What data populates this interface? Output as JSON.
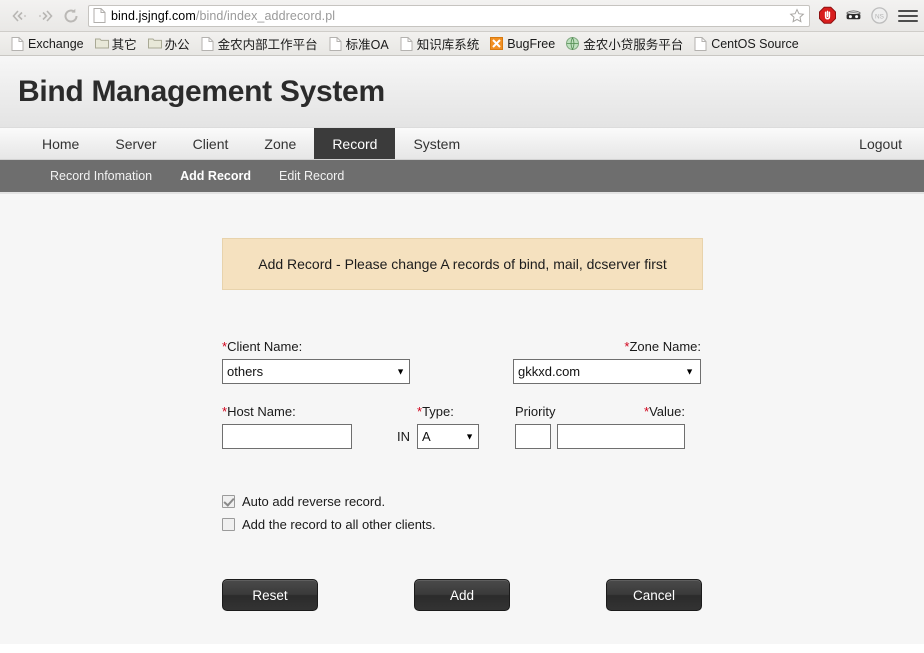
{
  "browser": {
    "back_label": "Back",
    "forward_label": "Forward",
    "reload_label": "Reload",
    "url_domain": "bind.jsjngf.com",
    "url_path": "/bind/index_addrecord.pl",
    "url_full": "bind.jsjngf.com/bind/index_addrecord.pl",
    "bookmark_star": "bookmark-star-icon",
    "extensions": [
      {
        "name": "adblock-icon",
        "label": "AdBlock"
      },
      {
        "name": "privacy-mask-icon",
        "label": "Privacy Badger"
      },
      {
        "name": "noscript-icon",
        "label": "NoScript"
      }
    ],
    "menu_label": "Open menu",
    "bookmarks": [
      {
        "label": "Exchange",
        "icon": "page-icon"
      },
      {
        "label": "其它",
        "icon": "folder-icon"
      },
      {
        "label": "办公",
        "icon": "folder-icon"
      },
      {
        "label": "金农内部工作平台",
        "icon": "page-icon"
      },
      {
        "label": "标准OA",
        "icon": "page-icon"
      },
      {
        "label": "知识库系统",
        "icon": "page-icon"
      },
      {
        "label": "BugFree",
        "icon": "bugfree-icon"
      },
      {
        "label": "金农小贷服务平台",
        "icon": "globe-icon"
      },
      {
        "label": "CentOS Source",
        "icon": "page-icon"
      }
    ]
  },
  "site": {
    "title": "Bind Management System",
    "mainnav": [
      {
        "label": "Home",
        "active": false
      },
      {
        "label": "Server",
        "active": false
      },
      {
        "label": "Client",
        "active": false
      },
      {
        "label": "Zone",
        "active": false
      },
      {
        "label": "Record",
        "active": true
      },
      {
        "label": "System",
        "active": false
      }
    ],
    "logout_label": "Logout",
    "subnav": [
      {
        "label": "Record Infomation",
        "active": false
      },
      {
        "label": "Add Record",
        "active": true
      },
      {
        "label": "Edit Record",
        "active": false
      }
    ]
  },
  "form": {
    "alert_text": "Add Record - Please change A records of bind, mail, dcserver first",
    "client_name": {
      "label_required": "*",
      "label": "Client Name:",
      "value": "others",
      "options": [
        "others"
      ]
    },
    "zone_name": {
      "label_required": "*",
      "label": "Zone Name:",
      "value": "gkkxd.com",
      "options": [
        "gkkxd.com"
      ]
    },
    "host_name": {
      "label_required": "*",
      "label": "Host Name:",
      "value": "",
      "placeholder": ""
    },
    "in_text": "IN",
    "type": {
      "label_required": "*",
      "label": "Type:",
      "value": "A",
      "options": [
        "A"
      ]
    },
    "priority": {
      "label": "Priority",
      "value": "",
      "placeholder": ""
    },
    "value_field": {
      "label_required": "*",
      "label": "Value:",
      "value": "",
      "placeholder": ""
    },
    "checkbox_auto_reverse": {
      "label": "Auto add reverse record.",
      "checked": true
    },
    "checkbox_all_clients": {
      "label": "Add the record to all other clients.",
      "checked": false
    },
    "buttons": {
      "reset": "Reset",
      "add": "Add",
      "cancel": "Cancel"
    }
  },
  "colors": {
    "accent_dark": "#3b3b3b",
    "subnav_bg": "#6e6e6e",
    "alert_bg": "#f5e1bf",
    "required_red": "#d0021b",
    "button_dark": "#333333"
  }
}
